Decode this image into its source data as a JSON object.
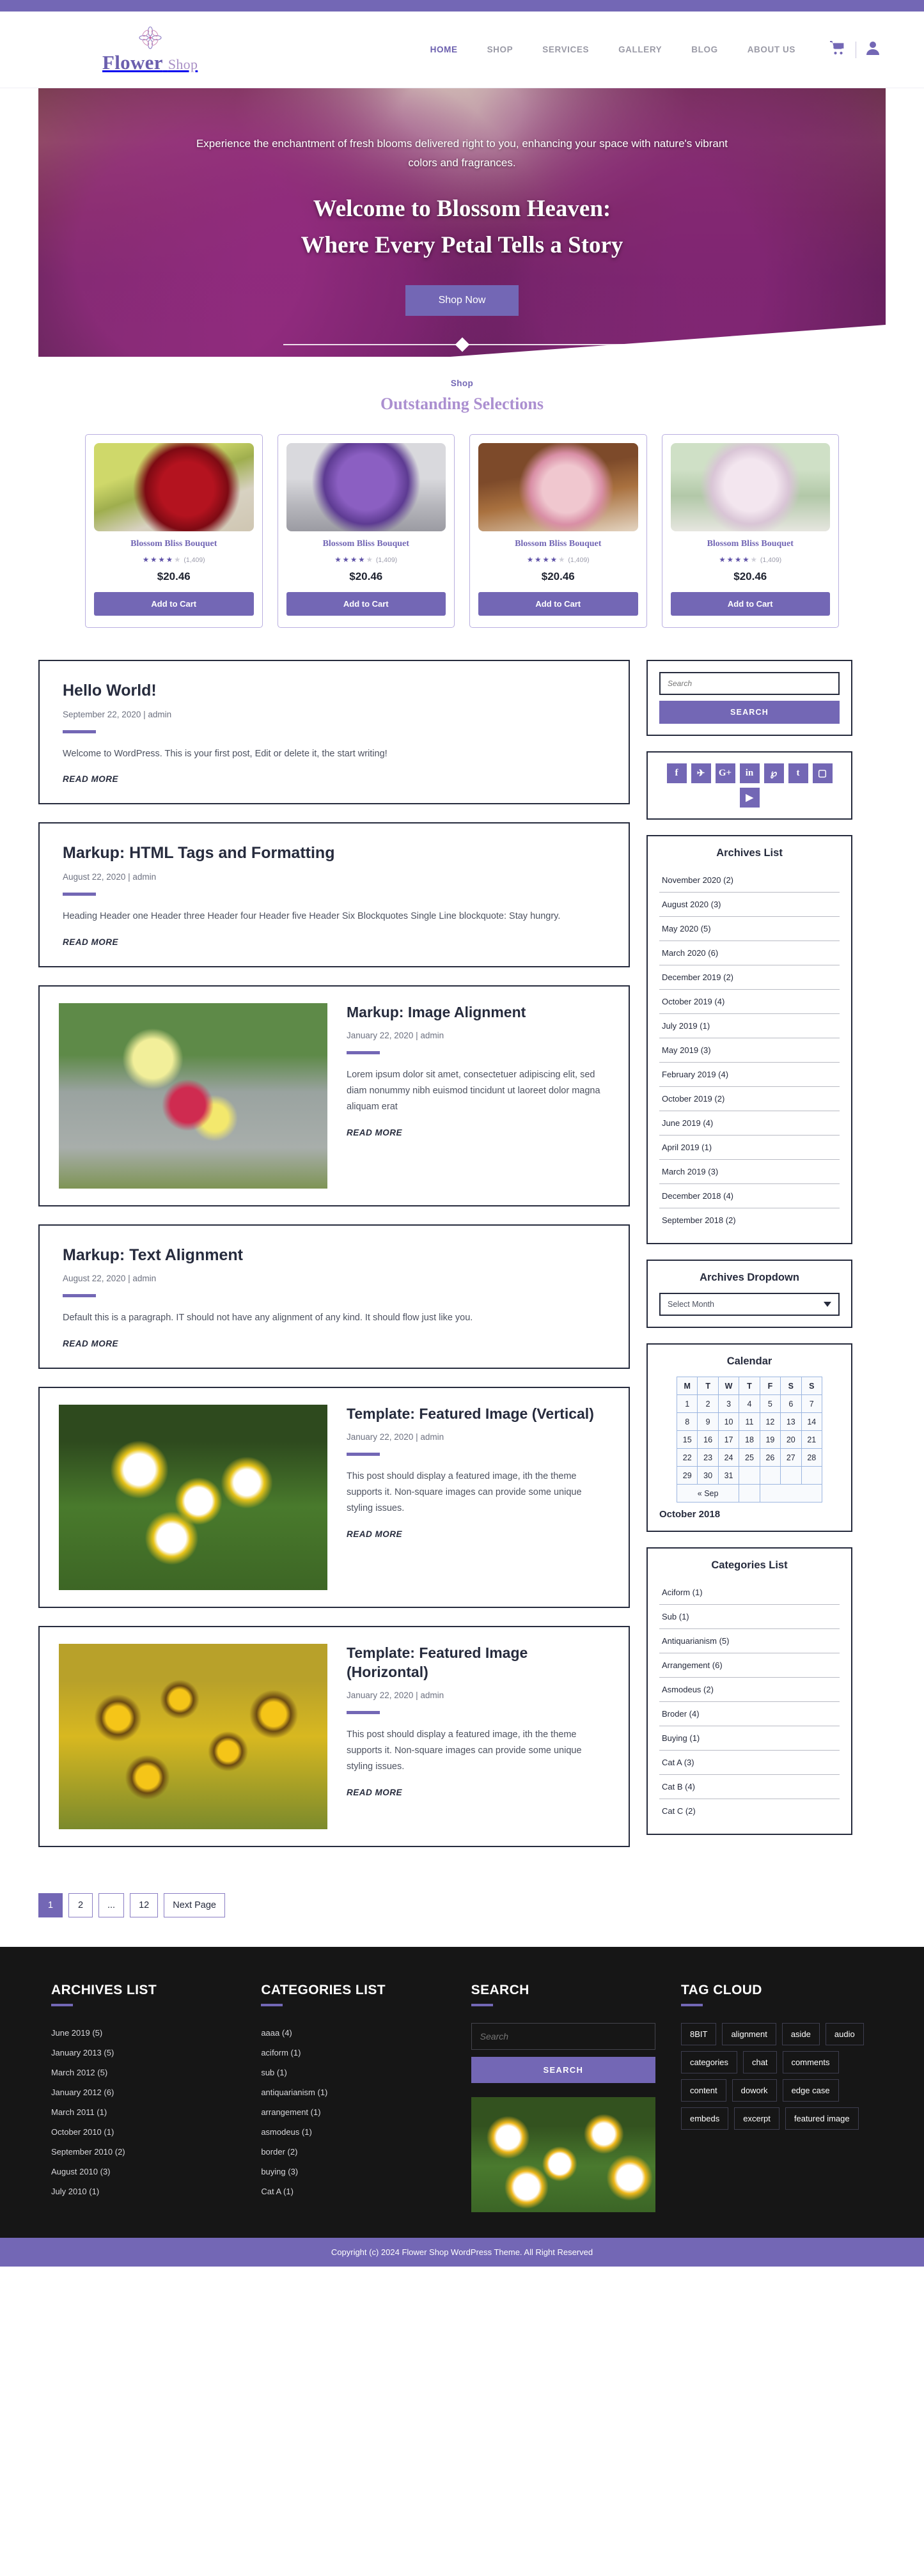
{
  "brand": {
    "name_primary": "Flower",
    "name_secondary": "Shop",
    "mark": "flower-logo-icon"
  },
  "nav": {
    "items": [
      {
        "label": "HOME",
        "active": true
      },
      {
        "label": "SHOP",
        "active": false
      },
      {
        "label": "SERVICES",
        "active": false
      },
      {
        "label": "GALLERY",
        "active": false
      },
      {
        "label": "BLOG",
        "active": false
      },
      {
        "label": "ABOUT US",
        "active": false
      }
    ],
    "cart_icon": "shopping-cart-icon",
    "account_icon": "user-account-icon"
  },
  "hero": {
    "subtitle": "Experience the enchantment of fresh blooms delivered right to you, enhancing your space with nature's vibrant colors and fragrances.",
    "title_line1": "Welcome to Blossom Heaven:",
    "title_line2": "Where Every Petal Tells a Story",
    "button": "Shop Now"
  },
  "shop": {
    "kicker": "Shop",
    "title": "Outstanding Selections",
    "products": [
      {
        "name": "Blossom Bliss Bouquet",
        "stars_filled": 4,
        "stars_total": 5,
        "reviews": "(1,409)",
        "price": "$20.46",
        "button": "Add to Cart"
      },
      {
        "name": "Blossom Bliss Bouquet",
        "stars_filled": 4,
        "stars_total": 5,
        "reviews": "(1,409)",
        "price": "$20.46",
        "button": "Add to Cart"
      },
      {
        "name": "Blossom Bliss Bouquet",
        "stars_filled": 4,
        "stars_total": 5,
        "reviews": "(1,409)",
        "price": "$20.46",
        "button": "Add to Cart"
      },
      {
        "name": "Blossom Bliss Bouquet",
        "stars_filled": 4,
        "stars_total": 5,
        "reviews": "(1,409)",
        "price": "$20.46",
        "button": "Add to Cart"
      }
    ]
  },
  "posts": [
    {
      "title": "Hello World!",
      "meta": "September 22, 2020 | admin",
      "excerpt": "Welcome to WordPress. This is your first post, Edit or delete it, the start writing!",
      "read_more": "READ MORE",
      "has_image": false
    },
    {
      "title": "Markup: HTML Tags and Formatting",
      "meta": "August 22, 2020 | admin",
      "excerpt": "Heading Header one Header three Header four Header five Header Six Blockquotes Single Line blockquote: Stay hungry.",
      "read_more": "READ MORE",
      "has_image": false
    },
    {
      "title": "Markup: Image Alignment",
      "meta": "January 22, 2020 | admin",
      "excerpt": "Lorem ipsum dolor sit amet, consectetuer adipiscing elit, sed diam nonummy nibh euismod tincidunt ut laoreet dolor magna aliquam erat",
      "read_more": "READ MORE",
      "has_image": true
    },
    {
      "title": "Markup: Text Alignment",
      "meta": "August 22, 2020 | admin",
      "excerpt": "Default this is a paragraph. IT should not have any alignment of any kind. It should flow just like you.",
      "read_more": "READ MORE",
      "has_image": false
    },
    {
      "title": "Template: Featured Image (Vertical)",
      "meta": "January 22, 2020 | admin",
      "excerpt": "This post should display a featured image, ith the theme supports it. Non-square images can provide some unique styling issues.",
      "read_more": "READ MORE",
      "has_image": true
    },
    {
      "title": "Template: Featured Image (Horizontal)",
      "meta": "January 22, 2020 | admin",
      "excerpt": "This post should display a featured image, ith the theme supports it. Non-square images can provide some unique styling issues.",
      "read_more": "READ MORE",
      "has_image": true
    }
  ],
  "pagination": {
    "pages": [
      "1",
      "2",
      "...",
      "12"
    ],
    "current": "1",
    "next_label": "Next Page"
  },
  "sidebar": {
    "search": {
      "placeholder": "Search",
      "button": "SEARCH"
    },
    "social": [
      {
        "glyph": "f",
        "name": "facebook-icon"
      },
      {
        "glyph": "✈",
        "name": "twitter-icon"
      },
      {
        "glyph": "G+",
        "name": "google-plus-icon"
      },
      {
        "glyph": "in",
        "name": "linkedin-icon"
      },
      {
        "glyph": "℘",
        "name": "pinterest-icon"
      },
      {
        "glyph": "t",
        "name": "tumblr-icon"
      },
      {
        "glyph": "▢",
        "name": "instagram-icon"
      },
      {
        "glyph": "▶",
        "name": "youtube-icon"
      }
    ],
    "archives_list": {
      "title": "Archives List",
      "items": [
        "November 2020 (2)",
        "August 2020 (3)",
        "May 2020 (5)",
        "March 2020 (6)",
        "December 2019 (2)",
        "October 2019 (4)",
        "July 2019 (1)",
        "May 2019 (3)",
        "February 2019 (4)",
        "October 2019 (2)",
        "June 2019 (4)",
        "April 2019 (1)",
        "March 2019 (3)",
        "December 2018 (4)",
        "September 2018 (2)"
      ]
    },
    "archives_dropdown": {
      "title": "Archives Dropdown",
      "selected": "Select Month"
    },
    "calendar": {
      "title": "Calendar",
      "weekdays": [
        "M",
        "T",
        "W",
        "T",
        "F",
        "S",
        "S"
      ],
      "weeks": [
        [
          "1",
          "2",
          "3",
          "4",
          "5",
          "6",
          "7"
        ],
        [
          "8",
          "9",
          "10",
          "11",
          "12",
          "13",
          "14"
        ],
        [
          "15",
          "16",
          "17",
          "18",
          "19",
          "20",
          "21"
        ],
        [
          "22",
          "23",
          "24",
          "25",
          "26",
          "27",
          "28"
        ],
        [
          "29",
          "30",
          "31",
          "",
          "",
          "",
          ""
        ]
      ],
      "prev_label": "« Sep",
      "month_label": "October 2018"
    },
    "categories_list": {
      "title": "Categories List",
      "items": [
        "Aciform (1)",
        "Sub (1)",
        "Antiquarianism (5)",
        "Arrangement (6)",
        "Asmodeus (2)",
        "Broder (4)",
        "Buying (1)",
        "Cat A (3)",
        "Cat B (4)",
        "Cat C (2)"
      ]
    }
  },
  "footer": {
    "archives": {
      "title": "ARCHIVES LIST",
      "items": [
        "June 2019 (5)",
        "January  2013 (5)",
        "March 2012 (5)",
        "January  2012 (6)",
        "March  2011 (1)",
        "October 2010 (1)",
        "September 2010 (2)",
        "August 2010 (3)",
        "July 2010 (1)"
      ]
    },
    "categories": {
      "title": "CATEGORIES LIST",
      "items": [
        "aaaa (4)",
        "aciform (1)",
        "sub (1)",
        "antiquarianism (1)",
        "arrangement (1)",
        "asmodeus (1)",
        "border (2)",
        "buying (3)",
        "Cat A (1)"
      ]
    },
    "search": {
      "title": "SEARCH",
      "placeholder": "Search",
      "button": "SEARCH"
    },
    "tagcloud": {
      "title": "TAG CLOUD",
      "tags": [
        "8BIT",
        "alignment",
        "aside",
        "audio",
        "categories",
        "chat",
        "comments",
        "content",
        "dowork",
        "edge case",
        "embeds",
        "excerpt",
        "featured image"
      ]
    },
    "copyright": "Copyright (c) 2024 Flower Shop WordPress Theme. All Right Reserved"
  },
  "colors": {
    "accent": "#7367b5",
    "dark": "#262b3d",
    "footer_bg": "#161616"
  }
}
